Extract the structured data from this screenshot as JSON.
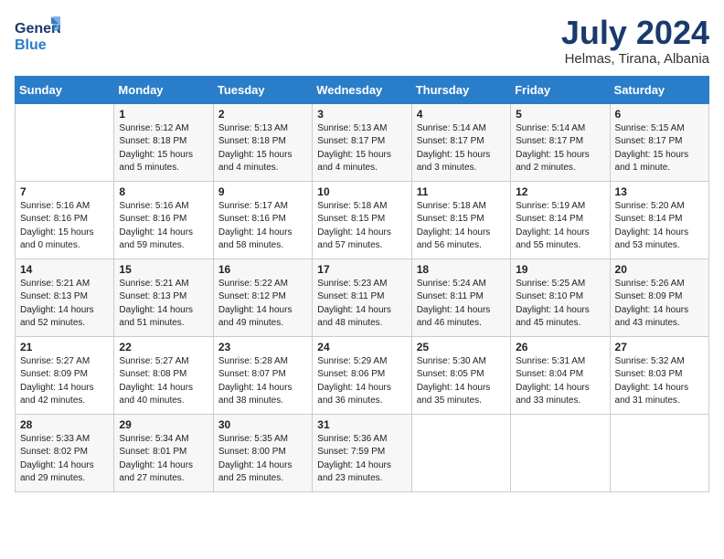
{
  "header": {
    "logo_line1": "General",
    "logo_line2": "Blue",
    "month_year": "July 2024",
    "location": "Helmas, Tirana, Albania"
  },
  "days_of_week": [
    "Sunday",
    "Monday",
    "Tuesday",
    "Wednesday",
    "Thursday",
    "Friday",
    "Saturday"
  ],
  "weeks": [
    [
      {
        "day": "",
        "info": ""
      },
      {
        "day": "1",
        "info": "Sunrise: 5:12 AM\nSunset: 8:18 PM\nDaylight: 15 hours\nand 5 minutes."
      },
      {
        "day": "2",
        "info": "Sunrise: 5:13 AM\nSunset: 8:18 PM\nDaylight: 15 hours\nand 4 minutes."
      },
      {
        "day": "3",
        "info": "Sunrise: 5:13 AM\nSunset: 8:17 PM\nDaylight: 15 hours\nand 4 minutes."
      },
      {
        "day": "4",
        "info": "Sunrise: 5:14 AM\nSunset: 8:17 PM\nDaylight: 15 hours\nand 3 minutes."
      },
      {
        "day": "5",
        "info": "Sunrise: 5:14 AM\nSunset: 8:17 PM\nDaylight: 15 hours\nand 2 minutes."
      },
      {
        "day": "6",
        "info": "Sunrise: 5:15 AM\nSunset: 8:17 PM\nDaylight: 15 hours\nand 1 minute."
      }
    ],
    [
      {
        "day": "7",
        "info": "Sunrise: 5:16 AM\nSunset: 8:16 PM\nDaylight: 15 hours\nand 0 minutes."
      },
      {
        "day": "8",
        "info": "Sunrise: 5:16 AM\nSunset: 8:16 PM\nDaylight: 14 hours\nand 59 minutes."
      },
      {
        "day": "9",
        "info": "Sunrise: 5:17 AM\nSunset: 8:16 PM\nDaylight: 14 hours\nand 58 minutes."
      },
      {
        "day": "10",
        "info": "Sunrise: 5:18 AM\nSunset: 8:15 PM\nDaylight: 14 hours\nand 57 minutes."
      },
      {
        "day": "11",
        "info": "Sunrise: 5:18 AM\nSunset: 8:15 PM\nDaylight: 14 hours\nand 56 minutes."
      },
      {
        "day": "12",
        "info": "Sunrise: 5:19 AM\nSunset: 8:14 PM\nDaylight: 14 hours\nand 55 minutes."
      },
      {
        "day": "13",
        "info": "Sunrise: 5:20 AM\nSunset: 8:14 PM\nDaylight: 14 hours\nand 53 minutes."
      }
    ],
    [
      {
        "day": "14",
        "info": "Sunrise: 5:21 AM\nSunset: 8:13 PM\nDaylight: 14 hours\nand 52 minutes."
      },
      {
        "day": "15",
        "info": "Sunrise: 5:21 AM\nSunset: 8:13 PM\nDaylight: 14 hours\nand 51 minutes."
      },
      {
        "day": "16",
        "info": "Sunrise: 5:22 AM\nSunset: 8:12 PM\nDaylight: 14 hours\nand 49 minutes."
      },
      {
        "day": "17",
        "info": "Sunrise: 5:23 AM\nSunset: 8:11 PM\nDaylight: 14 hours\nand 48 minutes."
      },
      {
        "day": "18",
        "info": "Sunrise: 5:24 AM\nSunset: 8:11 PM\nDaylight: 14 hours\nand 46 minutes."
      },
      {
        "day": "19",
        "info": "Sunrise: 5:25 AM\nSunset: 8:10 PM\nDaylight: 14 hours\nand 45 minutes."
      },
      {
        "day": "20",
        "info": "Sunrise: 5:26 AM\nSunset: 8:09 PM\nDaylight: 14 hours\nand 43 minutes."
      }
    ],
    [
      {
        "day": "21",
        "info": "Sunrise: 5:27 AM\nSunset: 8:09 PM\nDaylight: 14 hours\nand 42 minutes."
      },
      {
        "day": "22",
        "info": "Sunrise: 5:27 AM\nSunset: 8:08 PM\nDaylight: 14 hours\nand 40 minutes."
      },
      {
        "day": "23",
        "info": "Sunrise: 5:28 AM\nSunset: 8:07 PM\nDaylight: 14 hours\nand 38 minutes."
      },
      {
        "day": "24",
        "info": "Sunrise: 5:29 AM\nSunset: 8:06 PM\nDaylight: 14 hours\nand 36 minutes."
      },
      {
        "day": "25",
        "info": "Sunrise: 5:30 AM\nSunset: 8:05 PM\nDaylight: 14 hours\nand 35 minutes."
      },
      {
        "day": "26",
        "info": "Sunrise: 5:31 AM\nSunset: 8:04 PM\nDaylight: 14 hours\nand 33 minutes."
      },
      {
        "day": "27",
        "info": "Sunrise: 5:32 AM\nSunset: 8:03 PM\nDaylight: 14 hours\nand 31 minutes."
      }
    ],
    [
      {
        "day": "28",
        "info": "Sunrise: 5:33 AM\nSunset: 8:02 PM\nDaylight: 14 hours\nand 29 minutes."
      },
      {
        "day": "29",
        "info": "Sunrise: 5:34 AM\nSunset: 8:01 PM\nDaylight: 14 hours\nand 27 minutes."
      },
      {
        "day": "30",
        "info": "Sunrise: 5:35 AM\nSunset: 8:00 PM\nDaylight: 14 hours\nand 25 minutes."
      },
      {
        "day": "31",
        "info": "Sunrise: 5:36 AM\nSunset: 7:59 PM\nDaylight: 14 hours\nand 23 minutes."
      },
      {
        "day": "",
        "info": ""
      },
      {
        "day": "",
        "info": ""
      },
      {
        "day": "",
        "info": ""
      }
    ]
  ]
}
